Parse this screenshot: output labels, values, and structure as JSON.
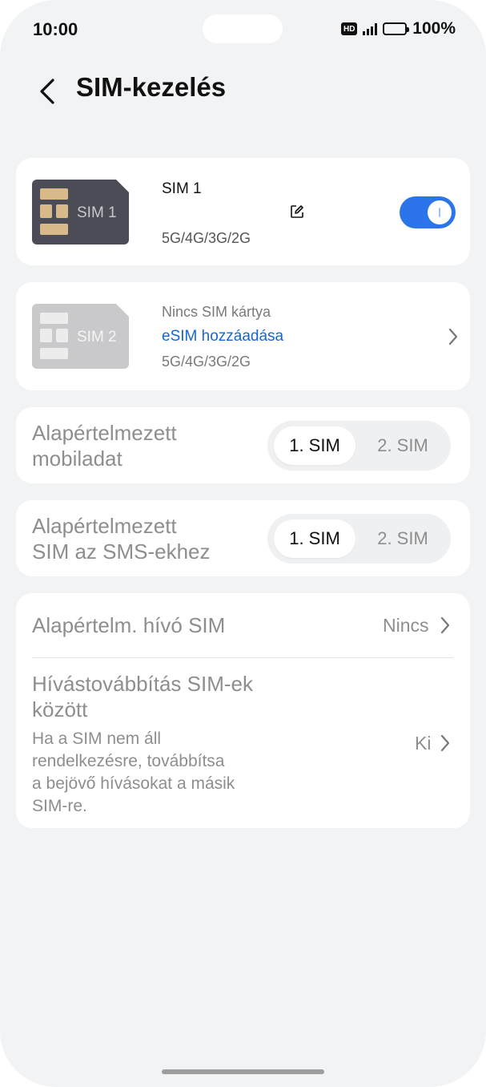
{
  "status": {
    "time": "10:00",
    "hd": "HD",
    "battery": "100%"
  },
  "header": {
    "title": "SIM-kezelés"
  },
  "sim1": {
    "card_label": "SIM 1",
    "name": "SIM 1",
    "network": "5G/4G/3G/2G",
    "enabled": true
  },
  "sim2": {
    "card_label": "SIM 2",
    "status": "Nincs SIM kártya",
    "add_esim": "eSIM hozzáadása",
    "network": "5G/4G/3G/2G"
  },
  "default_data": {
    "title_line1": "Alapértelmezett",
    "title_line2": "mobiladat",
    "opt1": "1. SIM",
    "opt2": "2. SIM",
    "selected": "1. SIM"
  },
  "default_sms": {
    "title_line1": "Alapértelmezett",
    "title_line2": "SIM az SMS-ekhez",
    "opt1": "1. SIM",
    "opt2": "2. SIM",
    "selected": "1. SIM"
  },
  "calls": {
    "default_call_label": "Alapértelm. hívó SIM",
    "default_call_value": "Nincs",
    "forward_title_line1": "Hívástovábbítás SIM-ek",
    "forward_title_line2": "között",
    "forward_desc_line1": "Ha a SIM nem áll",
    "forward_desc_line2": "rendelkezésre, továbbítsa",
    "forward_desc_line3": "a bejövő hívásokat a másik",
    "forward_desc_line4": "SIM-re.",
    "forward_value": "Ki"
  },
  "colors": {
    "accent": "#2b74ea",
    "link": "#1565d8",
    "background": "#f1f3f5"
  }
}
